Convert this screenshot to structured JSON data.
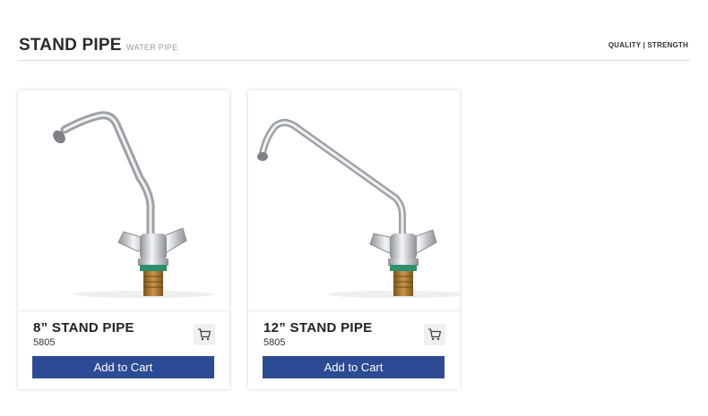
{
  "header": {
    "title": "STAND PIPE",
    "subtitle": "WATER PIPE",
    "tagline": "QUALITY | STRENGTH"
  },
  "products": [
    {
      "name": "8” STAND PIPE",
      "code": "5805",
      "add_to_cart_label": "Add to Cart",
      "image_icon": "faucet-image",
      "cart_icon": "cart-icon"
    },
    {
      "name": "12” STAND PIPE",
      "code": "5805",
      "add_to_cart_label": "Add to Cart",
      "image_icon": "faucet-image",
      "cart_icon": "cart-icon"
    }
  ],
  "colors": {
    "button": "#2d4b94",
    "divider": "#dcdcdc",
    "chrome": "#c9ccd0",
    "brass": "#b4832f",
    "seal": "#2e8f6a"
  }
}
